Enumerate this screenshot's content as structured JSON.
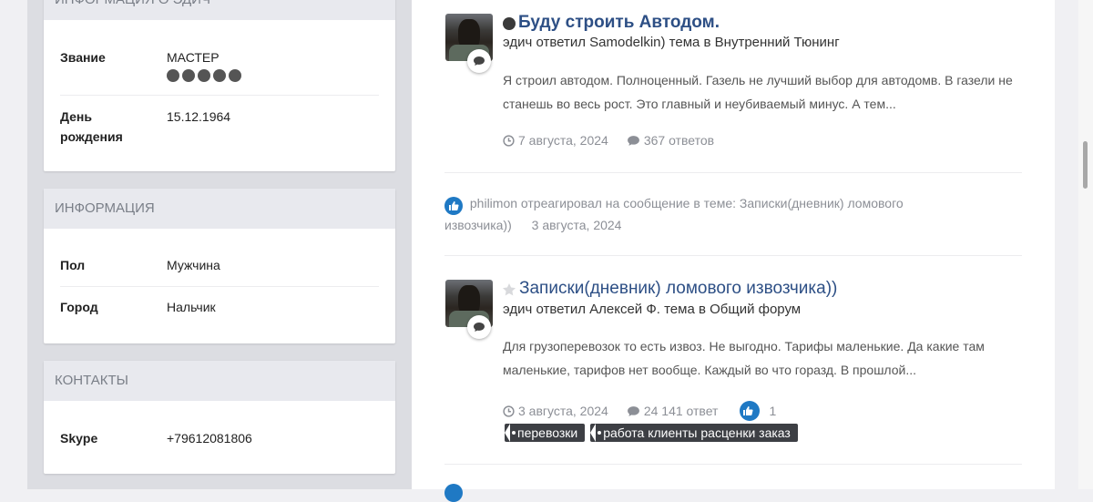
{
  "sidebar": {
    "card1": {
      "header": "ИНФОРМАЦИЯ О ЭДИЧ",
      "rows": [
        {
          "label": "Звание",
          "value": "МАСТЕР"
        },
        {
          "label": "День рождения",
          "label_line1": "День",
          "label_line2": "рождения",
          "value": "15.12.1964"
        }
      ],
      "rank_pips": 5
    },
    "card2": {
      "header": "ИНФОРМАЦИЯ",
      "rows": [
        {
          "label": "Пол",
          "value": "Мужчина"
        },
        {
          "label": "Город",
          "value": "Нальчик"
        }
      ]
    },
    "card3": {
      "header": "КОНТАКТЫ",
      "rows": [
        {
          "label": "Skype",
          "value": "+79612081806"
        }
      ]
    }
  },
  "feed": {
    "item1": {
      "title": "Буду строить Автодом.",
      "subtitle": "эдич ответил Samodelkin) тема в Внутренний Тюнинг",
      "excerpt": "Я строил автодом. Полноценный. Газель не лучший выбор для автодомв. В газели не станешь во весь рост. Это главный и неубиваемый минус. А тем...",
      "date": "7 августа, 2024",
      "replies": "367 ответов",
      "status_icon": "unread-dot-icon"
    },
    "reaction": {
      "text": "philimon отреагировал на сообщение в теме: Записки(дневник) ломового извозчика))",
      "date": "3 августа, 2024",
      "icon": "like-icon"
    },
    "item2": {
      "title": "Записки(дневник) ломового извозчика))",
      "subtitle": "эдич ответил Алексей Ф. тема в Общий форум",
      "excerpt": "Для грузоперевозок то есть извоз. Не выгодно. Тарифы маленькие. Да какие там маленькие, тарифов нет вообще. Каждый во что горазд. В прошлой...",
      "date": "3 августа, 2024",
      "replies": "24 141 ответ",
      "likes": "1",
      "tags": [
        "перевозки",
        "работа клиенты расценки заказ"
      ],
      "status_icon": "star-icon"
    }
  },
  "colors": {
    "link": "#2d4f85",
    "like": "#1f79c4",
    "tag_bg": "#3d3f44"
  }
}
